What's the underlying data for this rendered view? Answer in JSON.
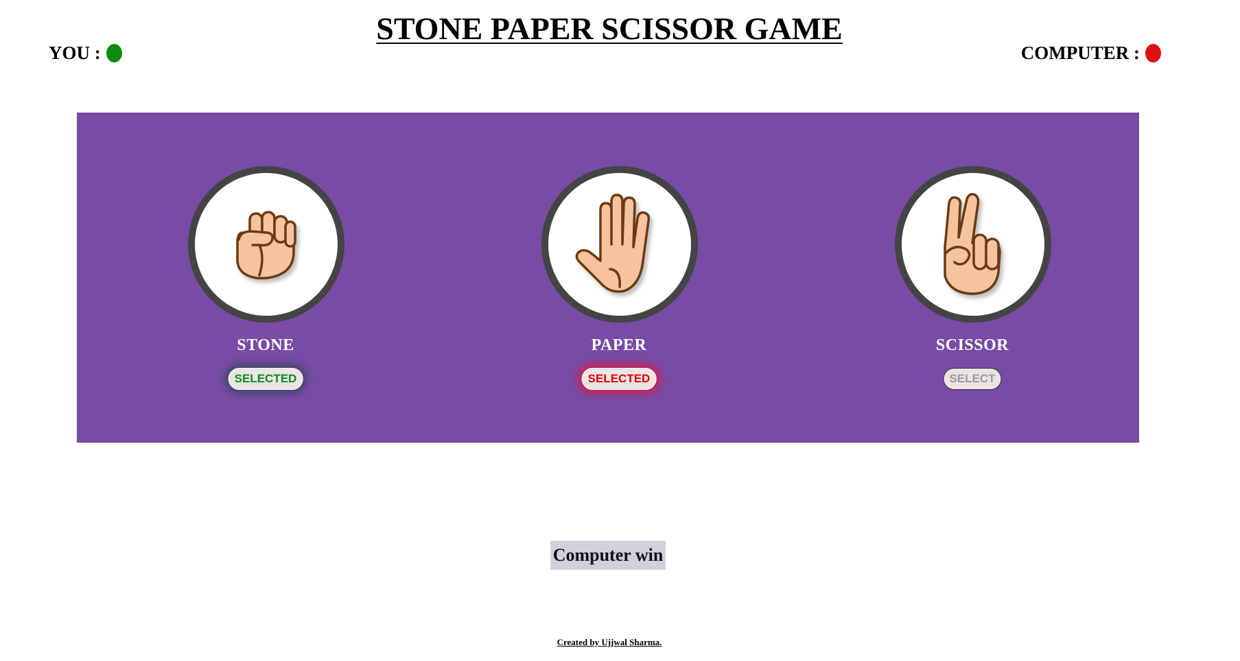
{
  "title": "STONE PAPER SCISSOR GAME",
  "scores": {
    "you_label": "YOU :",
    "you_color": "#0f8a0f",
    "computer_label": "COMPUTER :",
    "computer_color": "#dd1111"
  },
  "panel_color": "#784ba4",
  "choices": [
    {
      "label": "STONE",
      "icon": "fist-icon",
      "button": "SELECTED",
      "state": "selected-you"
    },
    {
      "label": "PAPER",
      "icon": "open-hand-icon",
      "button": "SELECTED",
      "state": "selected-computer"
    },
    {
      "label": "SCISSOR",
      "icon": "peace-hand-icon",
      "button": "SELECT",
      "state": "idle"
    }
  ],
  "result": "Computer win",
  "credit": "Created by Ujjwal Sharma."
}
